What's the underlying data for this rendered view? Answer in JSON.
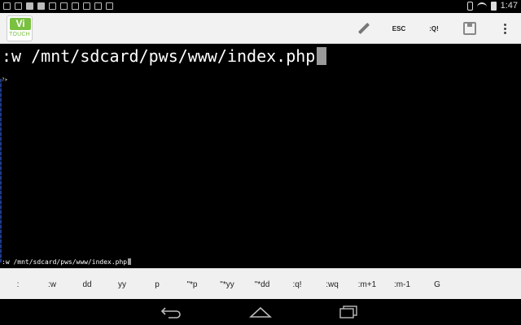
{
  "status_bar": {
    "time": "1:47"
  },
  "action_bar": {
    "app_logo_top": "Vi",
    "app_logo_bottom": "TOUCH",
    "esc_label": "ESC",
    "quit_label": ":Q!"
  },
  "editor": {
    "command_line": ":w /mnt/sdcard/pws/www/index.php",
    "prompt": "?>",
    "status_line": ":w /mnt/sdcard/pws/www/index.php"
  },
  "key_bar": {
    "keys": [
      ":",
      ":w",
      "dd",
      "yy",
      "p",
      "\"*p",
      "\"*yy",
      "\"*dd",
      ":q!",
      ":wq",
      ":m+1",
      ":m-1",
      "G"
    ]
  },
  "colors": {
    "editor_bg": "#000000",
    "editor_text": "#ffffff",
    "cursor": "#9a9a9a",
    "logo_green": "#7ac142",
    "bar_bg": "#f0f0f0"
  }
}
